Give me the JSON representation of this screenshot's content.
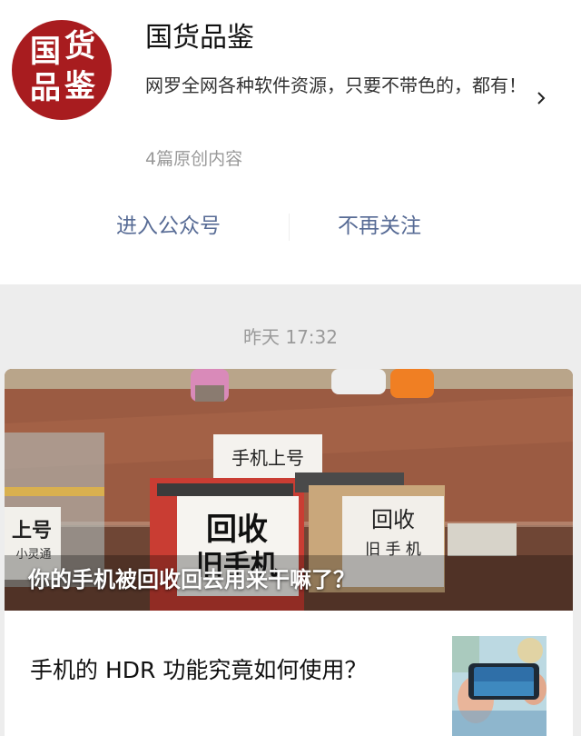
{
  "account": {
    "avatar_text": [
      "国",
      "货",
      "品",
      "鉴"
    ],
    "name": "国货品鉴",
    "description": "网罗全网各种软件资源，只要不带色的，都有！",
    "meta": "4篇原创内容"
  },
  "actions": {
    "enter": "进入公众号",
    "unfollow": "不再关注"
  },
  "feed": {
    "timestamp": "昨天 17:32",
    "articles": [
      {
        "title": "你的手机被回收回去用来干嘛了？",
        "cover_signs": {
          "top_sign": "手机上号",
          "main_sign_line1": "回收",
          "main_sign_line2": "旧手机",
          "right_sign_line1": "回收",
          "right_sign_line2": "旧 手 机",
          "left_sign": "上号",
          "left_sign_small": "小灵通"
        }
      },
      {
        "title": "手机的 HDR 功能究竟如何使用？"
      }
    ]
  },
  "colors": {
    "accent": "#576b95",
    "avatar_red": "#a81c1f",
    "background": "#ededed"
  },
  "icons": {
    "chevron": "chevron-right-icon"
  }
}
